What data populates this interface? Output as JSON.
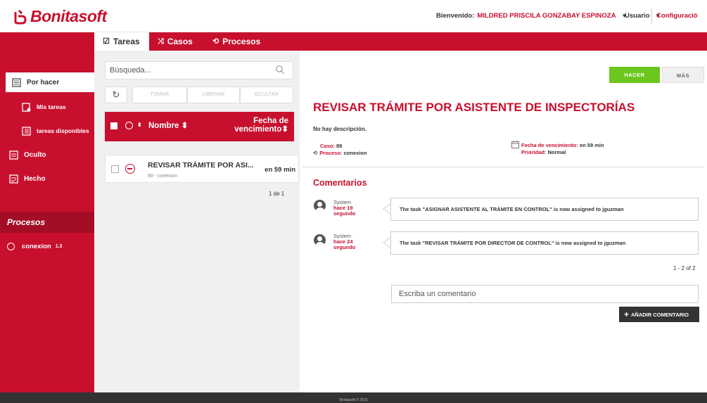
{
  "app": {
    "logo_text": "Bonitasoft",
    "brand_color": "#c8102e",
    "accent_green": "#6cc61e"
  },
  "header": {
    "welcome_label": "Bienvenido:",
    "user_name": "MILDRED PRISCILA GONZABAY ESPINOZA",
    "user_menu": "Usuario",
    "config_label": "Configuració"
  },
  "tabs": [
    {
      "label": "Tareas",
      "icon": "checkbox-icon"
    },
    {
      "label": "Casos",
      "icon": "shuffle-icon"
    },
    {
      "label": "Procesos",
      "icon": "process-icon"
    }
  ],
  "sidebar": {
    "items": [
      {
        "label": "Por hacer",
        "icon": "inbox-icon"
      },
      {
        "label": "Mis tareas",
        "icon": "my-tasks-icon"
      },
      {
        "label": "tareas disponibles",
        "icon": "available-tasks-icon"
      },
      {
        "label": "Oculto",
        "icon": "hidden-icon"
      },
      {
        "label": "Hecho",
        "icon": "done-icon"
      }
    ],
    "procesos_heading": "Procesos",
    "process_name": "conexion",
    "process_version": "1.3"
  },
  "list": {
    "search_placeholder": "Búsqueda...",
    "refresh_glyph": "↻",
    "btn_tomar": "TOMAR",
    "btn_liberar": "LIBERAR",
    "btn_ocultar": "OCULTAR",
    "col_sort_glyph": "⬍",
    "col_name": "Nombre ⬍",
    "col_due_1": "Fecha de",
    "col_due_2": "vencimiento⬍",
    "task_title": "REVISAR TRÁMITE POR ASI...",
    "task_sub": "89 - conexion",
    "task_due": "en 59 min",
    "pager": "1 de 1"
  },
  "detail": {
    "btn_hacer": "HACER",
    "btn_mas": "MÁS",
    "title": "REVISAR TRÁMITE POR ASISTENTE DE INSPECTORÍAS",
    "no_desc": "No hay descripción.",
    "caso_label": "Caso:",
    "caso_value": "89",
    "proceso_label": "Proceso:",
    "proceso_value": "conexion",
    "due_label": "Fecha de vencimiento:",
    "due_value": "en 59 min",
    "prio_label": "Prioridad:",
    "prio_value": "Normal",
    "comments_heading": "Comentarios",
    "comments": [
      {
        "who": "System",
        "when_1": "hace 19",
        "when_2": "segundo",
        "text": "The task \"ASIGNAR ASISTENTE AL TRÁMITE EN CONTROL\" is now assigned to jguzman"
      },
      {
        "who": "System",
        "when_1": "hace 24",
        "when_2": "segundo",
        "text": "The task \"REVISAR TRÁMITE POR DIRECTOR DE CONTROL\" is now assigned to jguzman"
      }
    ],
    "comments_pager": "1 - 2 of 2",
    "comment_placeholder": "Escriba un comentario",
    "btn_add_comment": "AÑADIR COMENTARIO"
  },
  "footer": {
    "text": "Bonitasoft © 2016"
  }
}
